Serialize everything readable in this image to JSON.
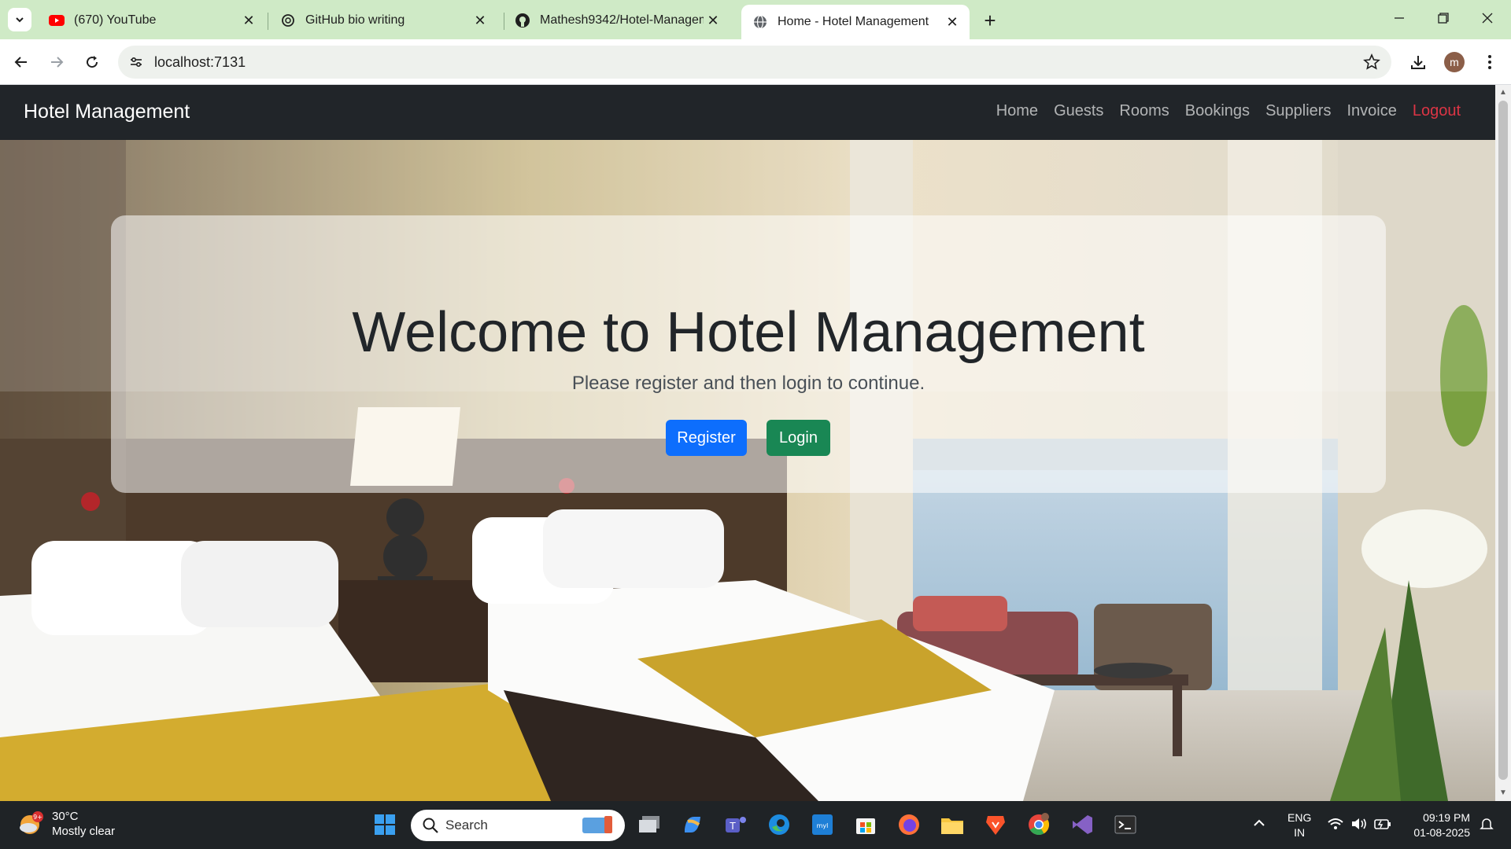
{
  "browser": {
    "tabs": [
      {
        "title": "(670) YouTube",
        "icon": "youtube-icon"
      },
      {
        "title": "GitHub bio writing",
        "icon": "openai-icon"
      },
      {
        "title": "Mathesh9342/Hotel-Management",
        "icon": "github-icon"
      },
      {
        "title": "Home - Hotel Management",
        "icon": "globe-icon",
        "active": true
      }
    ],
    "url": "localhost:7131",
    "profile_initial": "m"
  },
  "navbar": {
    "brand": "Hotel Management",
    "links": [
      "Home",
      "Guests",
      "Rooms",
      "Bookings",
      "Suppliers",
      "Invoice"
    ],
    "logout": "Logout"
  },
  "hero": {
    "title": "Welcome to Hotel Management",
    "subtitle": "Please register and then login to continue.",
    "register_label": "Register",
    "login_label": "Login"
  },
  "taskbar": {
    "weather_temp": "30°C",
    "weather_desc": "Mostly clear",
    "weather_badge": "9+",
    "search_placeholder": "Search",
    "lang_1": "ENG",
    "lang_2": "IN",
    "time": "09:19 PM",
    "date": "01-08-2025"
  },
  "colors": {
    "navbar_bg": "#212529",
    "register": "#0d6efd",
    "login": "#198754",
    "logout": "#dc3545"
  }
}
